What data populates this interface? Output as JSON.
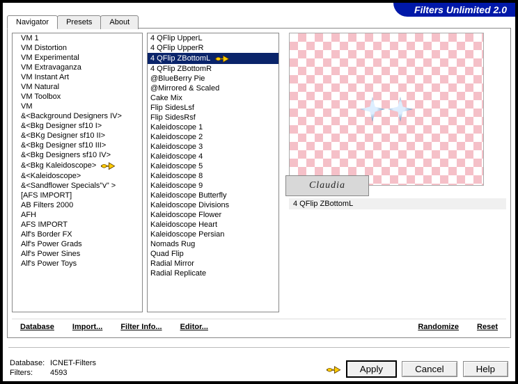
{
  "title": "Filters Unlimited 2.0",
  "tabs": [
    "Navigator",
    "Presets",
    "About"
  ],
  "activeTab": 0,
  "leftList": [
    "VM 1",
    "VM Distortion",
    "VM Experimental",
    "VM Extravaganza",
    "VM Instant Art",
    "VM Natural",
    "VM Toolbox",
    "VM",
    "&<Background Designers IV>",
    "&<Bkg Designer sf10 I>",
    "&<BKg Designer sf10 II>",
    "&<Bkg Designer sf10 III>",
    "&<Bkg Designers sf10 IV>",
    "&<Bkg Kaleidoscope>",
    "&<Kaleidoscope>",
    "&<Sandflower Specials\"v\" >",
    "[AFS IMPORT]",
    "AB Filters 2000",
    "AFH",
    "AFS IMPORT",
    "Alf's Border FX",
    "Alf's Power Grads",
    "Alf's Power Sines",
    "Alf's Power Toys"
  ],
  "leftPointerIndex": 13,
  "midList": [
    "4 QFlip UpperL",
    "4 QFlip UpperR",
    "4 QFlip ZBottomL",
    "4 QFlip ZBottomR",
    "@BlueBerry Pie",
    "@Mirrored & Scaled",
    "Cake Mix",
    "Flip SidesLsf",
    "Flip SidesRsf",
    "Kaleidoscope 1",
    "Kaleidoscope 2",
    "Kaleidoscope 3",
    "Kaleidoscope 4",
    "Kaleidoscope 5",
    "Kaleidoscope 8",
    "Kaleidoscope 9",
    "Kaleidoscope Butterfly",
    "Kaleidoscope Divisions",
    "Kaleidoscope Flower",
    "Kaleidoscope Heart",
    "Kaleidoscope Persian",
    "Nomads Rug",
    "Quad Flip",
    "Radial Mirror",
    "Radial Replicate"
  ],
  "midSelectedIndex": 2,
  "midPointerIndex": 2,
  "filterName": "4 QFlip ZBottomL",
  "watermark": "Claudia",
  "panelButtons": {
    "database": "Database",
    "import": "Import...",
    "filterInfo": "Filter Info...",
    "editor": "Editor...",
    "randomize": "Randomize",
    "reset": "Reset"
  },
  "footer": {
    "dbKey": "Database:",
    "dbVal": "ICNET-Filters",
    "filKey": "Filters:",
    "filVal": "4593"
  },
  "buttons": {
    "apply": "Apply",
    "cancel": "Cancel",
    "help": "Help"
  }
}
